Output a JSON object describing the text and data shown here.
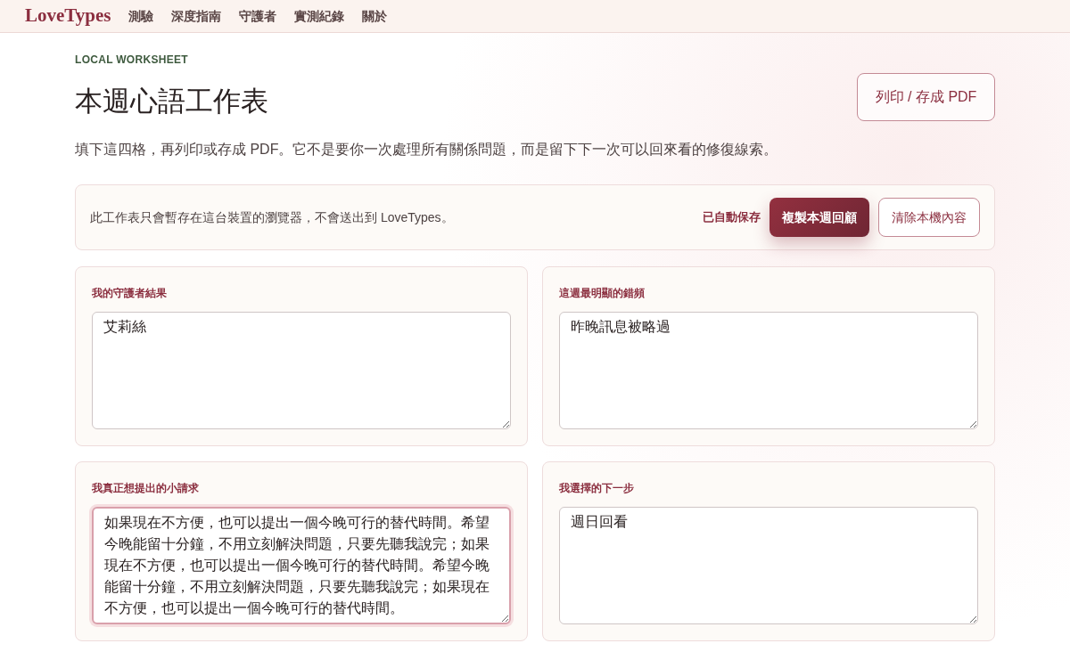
{
  "nav": {
    "logo": "LoveTypes",
    "links": [
      "測驗",
      "深度指南",
      "守護者",
      "實測紀錄",
      "關於"
    ]
  },
  "header": {
    "eyebrow": "LOCAL WORKSHEET",
    "title": "本週心語工作表",
    "print_button": "列印 / 存成 PDF",
    "intro": "填下這四格，再列印或存成 PDF。它不是要你一次處理所有關係問題，而是留下下一次可以回來看的修復線索。"
  },
  "notice": {
    "text": "此工作表只會暫存在這台裝置的瀏覽器，不會送出到 LoveTypes。",
    "status": "已自動保存",
    "buttons": [
      {
        "label": "複製本週回顧",
        "kind": "primary"
      },
      {
        "label": "清除本機內容",
        "kind": "secondary"
      }
    ]
  },
  "fields": [
    {
      "label": "我的守護者結果",
      "value": "艾莉絲",
      "focused": false
    },
    {
      "label": "這週最明顯的錯頻",
      "value": "昨晚訊息被略過",
      "focused": false
    },
    {
      "label": "我真正想提出的小請求",
      "value": "如果現在不方便，也可以提出一個今晚可行的替代時間。希望今晚能留十分鐘，不用立刻解決問題，只要先聽我說完；如果現在不方便，也可以提出一個今晚可行的替代時間。希望今晚能留十分鐘，不用立刻解決問題，只要先聽我說完；如果現在不方便，也可以提出一個今晚可行的替代時間。",
      "focused": true
    },
    {
      "label": "我選擇的下一步",
      "value": "週日回看",
      "focused": false
    }
  ]
}
